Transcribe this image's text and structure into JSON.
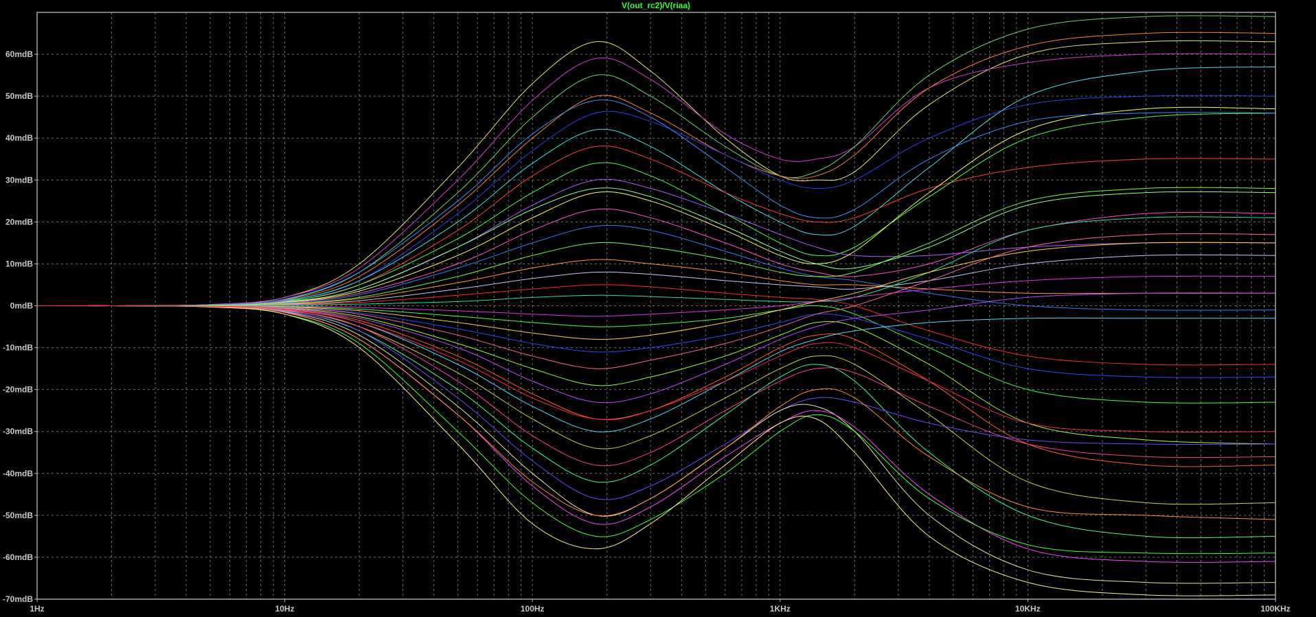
{
  "chart_data": {
    "type": "line",
    "title": "V(out_rc2)/V(riaa)",
    "x_scale": "log",
    "xlim": [
      1,
      100000
    ],
    "ylim": [
      -70,
      70
    ],
    "grid": true,
    "background_color": "#000000",
    "title_color": "#34ff34",
    "axis_text_color": "#c8c8c8",
    "x_ticks": [
      {
        "value": 1,
        "label": "1Hz"
      },
      {
        "value": 10,
        "label": "10Hz"
      },
      {
        "value": 100,
        "label": "100Hz"
      },
      {
        "value": 1000,
        "label": "1KHz"
      },
      {
        "value": 10000,
        "label": "10KHz"
      },
      {
        "value": 100000,
        "label": "100KHz"
      }
    ],
    "y_ticks": [
      {
        "value": 60,
        "label": "60mdB"
      },
      {
        "value": 50,
        "label": "50mdB"
      },
      {
        "value": 40,
        "label": "40mdB"
      },
      {
        "value": 30,
        "label": "30mdB"
      },
      {
        "value": 20,
        "label": "20mdB"
      },
      {
        "value": 10,
        "label": "10mdB"
      },
      {
        "value": 0,
        "label": "0mdB"
      },
      {
        "value": -10,
        "label": "-10mdB"
      },
      {
        "value": -20,
        "label": "-20mdB"
      },
      {
        "value": -30,
        "label": "-30mdB"
      },
      {
        "value": -40,
        "label": "-40mdB"
      },
      {
        "value": -50,
        "label": "-50mdB"
      },
      {
        "value": -60,
        "label": "-60mdB"
      },
      {
        "value": -70,
        "label": "-70mdB"
      }
    ],
    "x": [
      1,
      2,
      5,
      10,
      20,
      50,
      100,
      180,
      300,
      600,
      1000,
      1400,
      2000,
      4000,
      10000,
      30000,
      100000
    ],
    "series": [
      {
        "color": "#e8e070",
        "values": [
          0,
          0,
          0.3,
          2,
          10,
          33,
          53,
          63,
          56,
          40,
          31,
          30,
          32,
          48,
          60,
          63,
          63
        ]
      },
      {
        "color": "#d03bd0",
        "values": [
          0,
          0,
          0.3,
          2,
          9,
          30,
          49,
          59,
          54,
          41,
          35,
          35,
          38,
          52,
          58,
          60,
          60
        ]
      },
      {
        "color": "#70d070",
        "values": [
          0,
          0,
          0.2,
          1.5,
          8,
          27,
          45,
          55,
          50,
          38,
          31,
          32,
          38,
          55,
          66,
          69,
          69
        ]
      },
      {
        "color": "#ff7a40",
        "values": [
          0,
          0,
          0.2,
          1.4,
          7,
          24,
          40,
          50,
          46,
          36,
          31,
          31,
          36,
          52,
          62,
          65,
          65
        ]
      },
      {
        "color": "#2f3cf0",
        "values": [
          0,
          0,
          0.2,
          1.3,
          6,
          22,
          37,
          46,
          44,
          36,
          30,
          28,
          30,
          40,
          48,
          50,
          50
        ]
      },
      {
        "color": "#40e0e0",
        "values": [
          0,
          0,
          0.2,
          1.2,
          6,
          20,
          34,
          42,
          38,
          27,
          20,
          17,
          19,
          33,
          50,
          56,
          57
        ]
      },
      {
        "color": "#ff3c3c",
        "values": [
          0,
          0,
          0.1,
          1.1,
          5,
          18,
          31,
          38,
          35,
          27,
          22,
          20,
          21,
          28,
          33,
          35,
          35
        ]
      },
      {
        "color": "#50ff50",
        "values": [
          0,
          0,
          0.1,
          1,
          5,
          16,
          27,
          34,
          31,
          22,
          15,
          12,
          14,
          26,
          40,
          45,
          46
        ]
      },
      {
        "color": "#b05cff",
        "values": [
          0,
          0,
          0.1,
          0.9,
          4,
          14,
          24,
          30,
          28,
          22,
          17,
          14,
          12,
          12,
          14,
          15,
          15
        ]
      },
      {
        "color": "#ffff50",
        "values": [
          0,
          0,
          0.1,
          0.8,
          3.5,
          12,
          21,
          27,
          25,
          18,
          12,
          10,
          13,
          27,
          42,
          47,
          47
        ]
      },
      {
        "color": "#ff50c8",
        "values": [
          0,
          0,
          0.1,
          0.7,
          3,
          10,
          18,
          23,
          21,
          15,
          10,
          8,
          7,
          10,
          18,
          22,
          22
        ]
      },
      {
        "color": "#3c78ff",
        "values": [
          0,
          0,
          0.1,
          0.6,
          2.6,
          9,
          15,
          19,
          18,
          13,
          9,
          7,
          6,
          3,
          0,
          -1,
          -1
        ]
      },
      {
        "color": "#7cff3c",
        "values": [
          0,
          0,
          0.1,
          0.5,
          2,
          7,
          12,
          15,
          14,
          11,
          8,
          7,
          8,
          15,
          25,
          28,
          28
        ]
      },
      {
        "color": "#ff9632",
        "values": [
          0,
          0,
          0,
          0.4,
          1.7,
          5.5,
          9,
          11,
          10,
          8,
          6,
          5,
          5,
          4,
          3,
          3,
          3
        ]
      },
      {
        "color": "#c8c8ff",
        "values": [
          0,
          0,
          0,
          0.3,
          1.2,
          4,
          6.5,
          8,
          7.5,
          6,
          5,
          4.5,
          4,
          6,
          10,
          12,
          12
        ]
      },
      {
        "color": "#ff2828",
        "values": [
          0,
          0,
          0,
          0.2,
          0.8,
          2.5,
          4,
          5,
          4.5,
          3,
          2,
          1.5,
          0,
          -6,
          -12,
          -14,
          -14
        ]
      },
      {
        "color": "#28e6a0",
        "values": [
          0,
          0,
          0,
          0.1,
          0.4,
          1,
          2,
          2.5,
          2.2,
          1.5,
          1,
          1,
          2,
          8,
          18,
          21,
          21
        ]
      },
      {
        "color": "#e632e6",
        "values": [
          0,
          0,
          0,
          -0.1,
          -0.4,
          -1.2,
          -2,
          -2.5,
          -2,
          -1,
          0,
          1,
          2,
          4,
          6,
          7,
          7
        ]
      },
      {
        "color": "#46ff46",
        "values": [
          0,
          0,
          0,
          -0.2,
          -0.8,
          -2.5,
          -4,
          -5,
          -4.5,
          -3,
          -1,
          0,
          -2,
          -10,
          -20,
          -23,
          -23
        ]
      },
      {
        "color": "#ffd23c",
        "values": [
          0,
          0,
          0,
          -0.3,
          -1.2,
          -4,
          -6.5,
          -8,
          -7,
          -4,
          -1,
          1,
          3,
          8,
          13,
          15,
          15
        ]
      },
      {
        "color": "#3246ff",
        "values": [
          0,
          0,
          -0.1,
          -0.4,
          -1.7,
          -5.5,
          -9,
          -11,
          -10,
          -7,
          -4,
          -2,
          -3,
          -8,
          -15,
          -17,
          -17
        ]
      },
      {
        "color": "#ff64a0",
        "values": [
          0,
          0,
          -0.1,
          -0.5,
          -2,
          -7,
          -12,
          -15,
          -13,
          -9,
          -5,
          -2,
          0,
          6,
          14,
          17,
          17
        ]
      },
      {
        "color": "#a0ff28",
        "values": [
          0,
          0,
          -0.1,
          -0.6,
          -2.6,
          -9,
          -15,
          -19,
          -17,
          -12,
          -7,
          -4,
          -5,
          -14,
          -28,
          -32,
          -33
        ]
      },
      {
        "color": "#be46ff",
        "values": [
          0,
          0,
          -0.1,
          -0.7,
          -3,
          -10,
          -18,
          -23,
          -21,
          -14,
          -8,
          -5,
          -3,
          -1,
          2,
          3,
          3
        ]
      },
      {
        "color": "#ff5a28",
        "values": [
          0,
          0,
          -0.1,
          -0.8,
          -3.5,
          -12,
          -21,
          -27,
          -25,
          -17,
          -10,
          -7,
          -8,
          -18,
          -33,
          -38,
          -38
        ]
      },
      {
        "color": "#50dcff",
        "values": [
          0,
          0,
          -0.1,
          -0.9,
          -4,
          -14,
          -24,
          -30,
          -27,
          -18,
          -11,
          -8,
          -6,
          -4,
          -3,
          -3,
          -3
        ]
      },
      {
        "color": "#d2d23c",
        "values": [
          0,
          0,
          -0.1,
          -1,
          -5,
          -16,
          -27,
          -34,
          -31,
          -22,
          -15,
          -12,
          -14,
          -26,
          -42,
          -47,
          -47
        ]
      },
      {
        "color": "#ff3ca0",
        "values": [
          0,
          0,
          -0.1,
          -1.1,
          -5,
          -18,
          -31,
          -38,
          -35,
          -25,
          -18,
          -15,
          -16,
          -24,
          -33,
          -36,
          -36
        ]
      },
      {
        "color": "#3cff8c",
        "values": [
          0,
          0,
          -0.2,
          -1.2,
          -6,
          -20,
          -34,
          -42,
          -38,
          -26,
          -17,
          -14,
          -18,
          -35,
          -50,
          -55,
          -55
        ]
      },
      {
        "color": "#6e46ff",
        "values": [
          0,
          0,
          -0.2,
          -1.3,
          -6,
          -22,
          -37,
          -46,
          -43,
          -33,
          -25,
          -22,
          -23,
          -28,
          -32,
          -33,
          -33
        ]
      },
      {
        "color": "#e6e6a0",
        "values": [
          0,
          0,
          -0.2,
          -1.4,
          -7,
          -24,
          -40,
          -50,
          -46,
          -34,
          -25,
          -24,
          -30,
          -50,
          -63,
          -66,
          -66
        ]
      },
      {
        "color": "#ff46ff",
        "values": [
          0,
          0,
          -0.2,
          -1.5,
          -8,
          -26,
          -43,
          -52,
          -48,
          -36,
          -28,
          -25,
          -29,
          -45,
          -58,
          -61,
          -61
        ]
      },
      {
        "color": "#46ff32",
        "values": [
          0,
          0,
          -0.3,
          -2,
          -9,
          -30,
          -47,
          -55,
          -51,
          -40,
          -30,
          -26,
          -30,
          -46,
          -57,
          -59,
          -59
        ]
      },
      {
        "color": "#fff08c",
        "values": [
          0,
          0,
          -0.3,
          -2,
          -10,
          -33,
          -52,
          -58,
          -52,
          -38,
          -28,
          -27,
          -35,
          -55,
          -66,
          -69,
          -69
        ]
      },
      {
        "color": "#ff8c3c",
        "values": [
          0,
          0,
          -0.2,
          -1.6,
          -8,
          -26,
          -42,
          -50,
          -46,
          -34,
          -24,
          -20,
          -22,
          -36,
          -48,
          -50,
          -51
        ]
      },
      {
        "color": "#3c8cff",
        "values": [
          0,
          0,
          0.2,
          1.6,
          8,
          25,
          41,
          49,
          45,
          33,
          24,
          21,
          23,
          35,
          44,
          46,
          46
        ]
      },
      {
        "color": "#8cff8c",
        "values": [
          0,
          0,
          0.1,
          0.9,
          4,
          14,
          23,
          28,
          26,
          19,
          13,
          10,
          9,
          14,
          24,
          27,
          27
        ]
      },
      {
        "color": "#ff2850",
        "values": [
          0,
          0,
          -0.1,
          -0.9,
          -4,
          -13,
          -22,
          -27,
          -25,
          -18,
          -12,
          -9,
          -10,
          -18,
          -28,
          -30,
          -30
        ]
      }
    ]
  }
}
